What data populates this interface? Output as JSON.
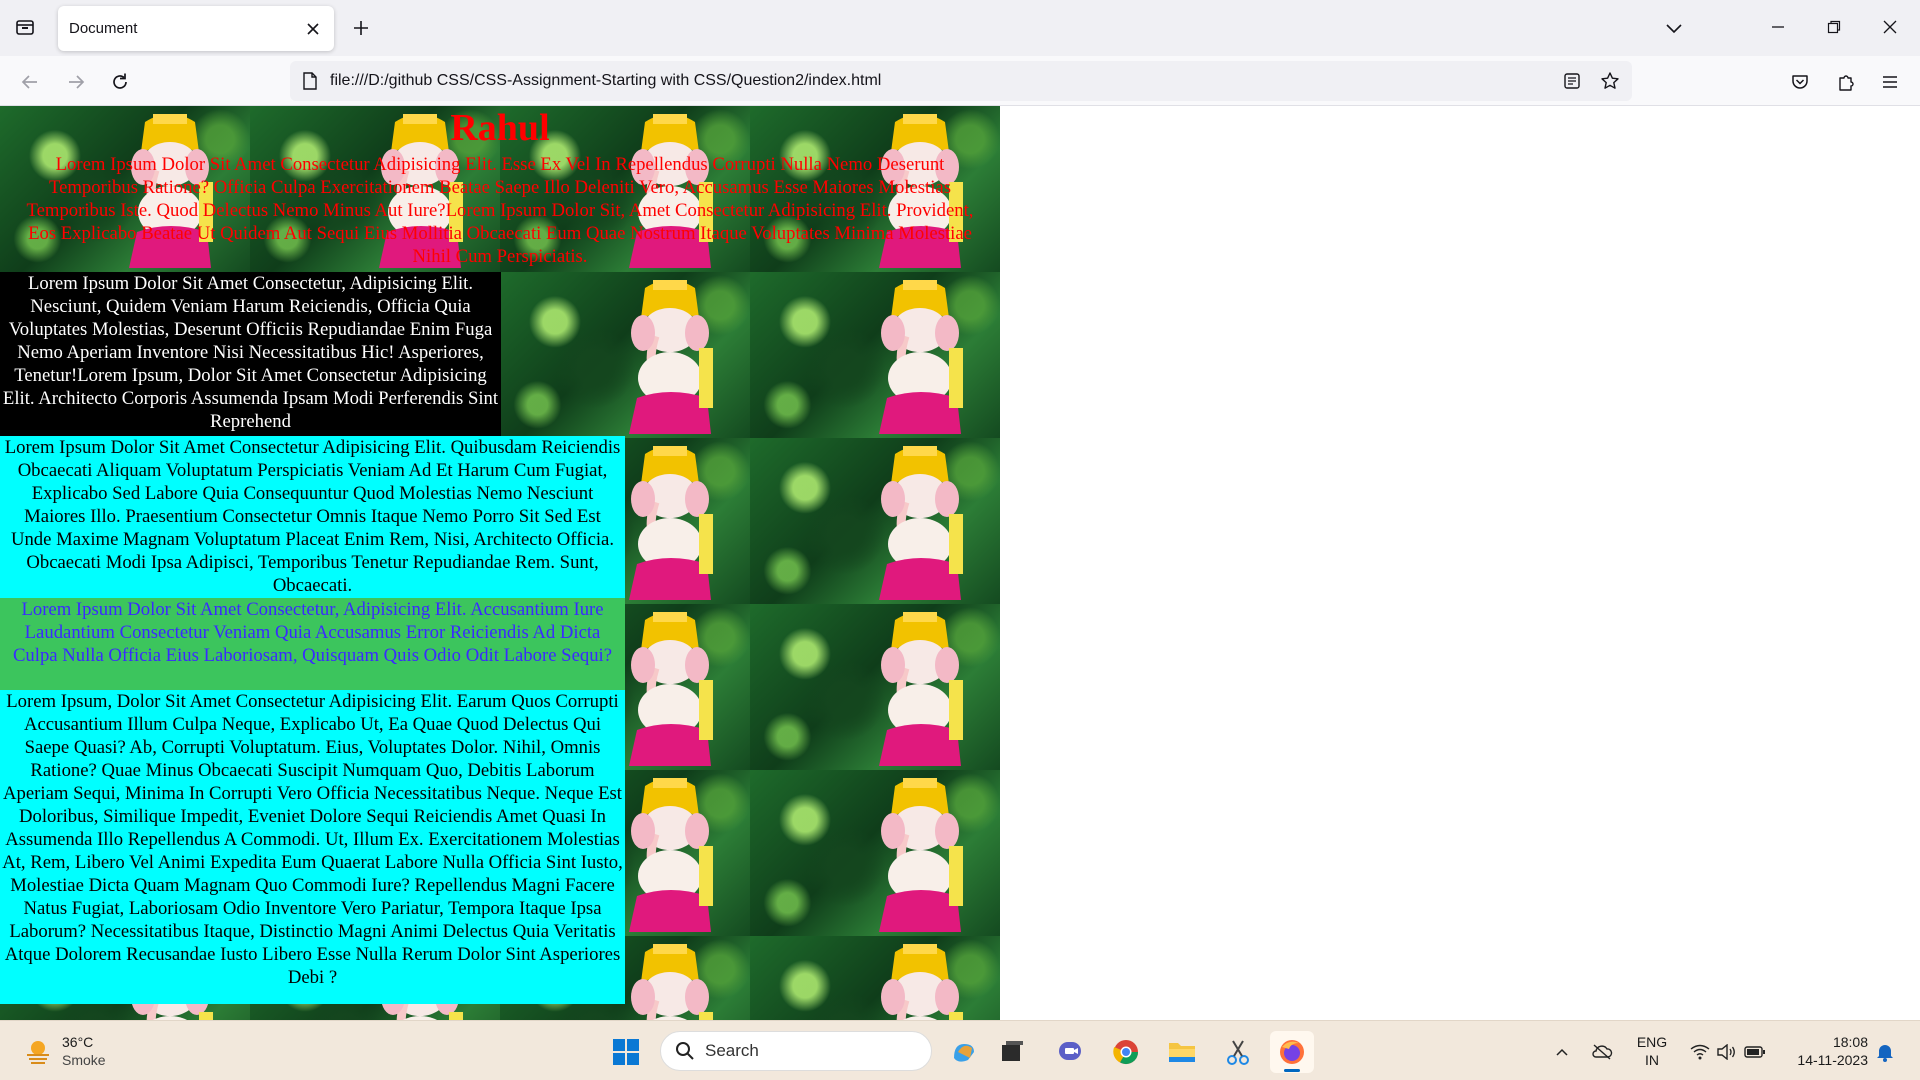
{
  "browser": {
    "tab_title": "Document",
    "url": "file:///D:/github CSS/CSS-Assignment-Starting with CSS/Question2/index.html"
  },
  "page": {
    "heading": "Rahul",
    "header_text": "Lorem Ipsum Dolor Sit Amet Consectetur Adipisicing Elit. Esse Ex Vel In Repellendus Corrupti Nulla Nemo Deserunt Temporibus Ratione? Officia Culpa Exercitationem Beatae Saepe Illo Deleniti Vero, Accusamus Esse Maiores Molestias Temporibus Iste. Quod Delectus Nemo Minus Aut Iure?Lorem Ipsum Dolor Sit, Amet Consectetur Adipisicing Elit. Provident, Eos Explicabo Beatae Ut Quidem Aut Sequi Eius Mollitia Obcaecati Eum Quae Nostrum Itaque Voluptates Minima Molestiae Nihil Cum Perspiciatis.",
    "black_text": "Lorem Ipsum Dolor Sit Amet Consectetur, Adipisicing Elit. Nesciunt, Quidem Veniam Harum Reiciendis, Officia Quia Voluptates Molestias, Deserunt Officiis Repudiandae Enim Fuga Nemo Aperiam Inventore Nisi Necessitatibus Hic! Asperiores, Tenetur!Lorem Ipsum, Dolor Sit Amet Consectetur Adipisicing Elit. Architecto Corporis Assumenda Ipsam Modi Perferendis Sint Reprehend",
    "cyan_text_1": "Lorem Ipsum Dolor Sit Amet Consectetur Adipisicing Elit. Quibusdam Reiciendis Obcaecati Aliquam Voluptatum Perspiciatis Veniam Ad Et Harum Cum Fugiat, Explicabo Sed Labore Quia Consequuntur Quod Molestias Nemo Nesciunt Maiores Illo. Praesentium Consectetur Omnis Itaque Nemo Porro Sit Sed Est Unde Maxime Magnam Voluptatum Placeat Enim Rem, Nisi, Architecto Officia. Obcaecati Modi Ipsa Adipisci, Temporibus Tenetur Repudiandae Rem. Sunt, Obcaecati.",
    "green_text": "Lorem Ipsum Dolor Sit Amet Consectetur, Adipisicing Elit. Accusantium Iure Laudantium Consectetur Veniam Quia Accusamus Error Reiciendis Ad Dicta Culpa Nulla Officia Eius Laboriosam, Quisquam Quis Odio Odit Labore Sequi?",
    "cyan_text_2": "Lorem Ipsum, Dolor Sit Amet Consectetur Adipisicing Elit. Earum Quos Corrupti Accusantium Illum Culpa Neque, Explicabo Ut, Ea Quae Quod Delectus Qui Saepe Quasi? Ab, Corrupti Voluptatum. Eius, Voluptates Dolor. Nihil, Omnis Ratione? Quae Minus Obcaecati Suscipit Numquam Quo, Debitis Laborum Aperiam Sequi, Minima In Corrupti Vero Officia Necessitatibus Neque. Neque Est Doloribus, Similique Impedit, Eveniet Dolore Sequi Reiciendis Amet Quasi In Assumenda Illo Repellendus A Commodi. Ut, Illum Ex. Exercitationem Molestias At, Rem, Libero Vel Animi Expedita Eum Quaerat Labore Nulla Officia Sint Iusto, Molestiae Dicta Quam Magnam Quo Commodi Iure? Repellendus Magni Facere Natus Fugiat, Laboriosam Odio Inventore Vero Pariatur, Tempora Itaque Ipsa Laborum? Necessitatibus Itaque, Distinctio Magni Animi Delectus Quia Veritatis Atque Dolorem Recusandae Iusto Libero Esse Nulla Rerum Dolor Sint Asperiores Debi ?"
  },
  "taskbar": {
    "weather_temp": "36°C",
    "weather_desc": "Smoke",
    "search_label": "Search",
    "lang_line1": "ENG",
    "lang_line2": "IN",
    "time": "18:08",
    "date": "14-11-2023"
  },
  "colors": {
    "header_text": "#ff0000",
    "cyan": "#00ffff",
    "green": "#3cc55d",
    "green_text": "#3a2aff"
  }
}
